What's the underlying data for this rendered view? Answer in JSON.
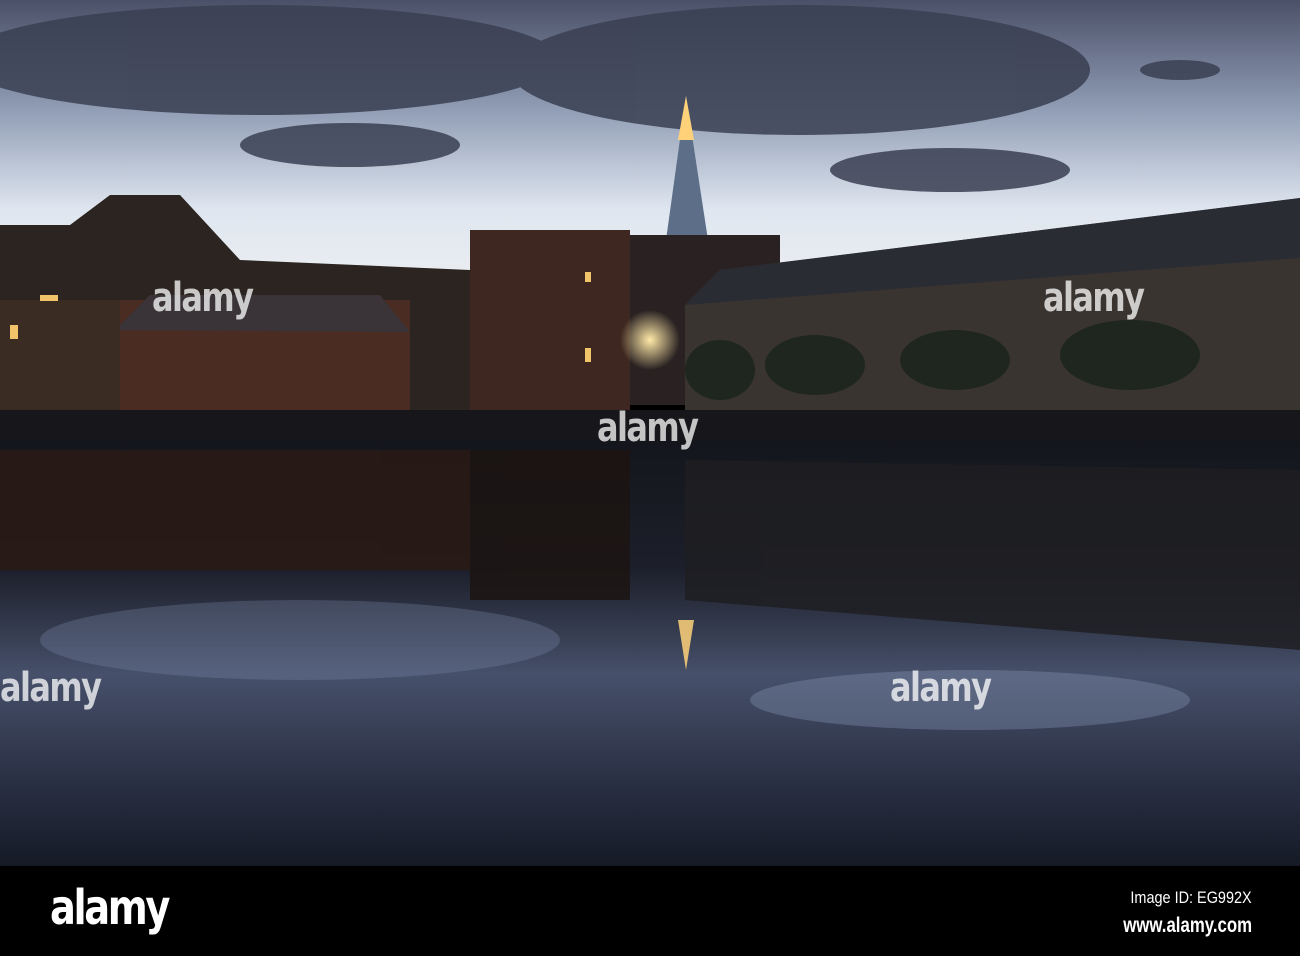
{
  "watermark": {
    "text": "alamy"
  },
  "footer": {
    "logo": "alamy",
    "image_id": "Image ID: EG992X",
    "website": "www.alamy.com"
  }
}
